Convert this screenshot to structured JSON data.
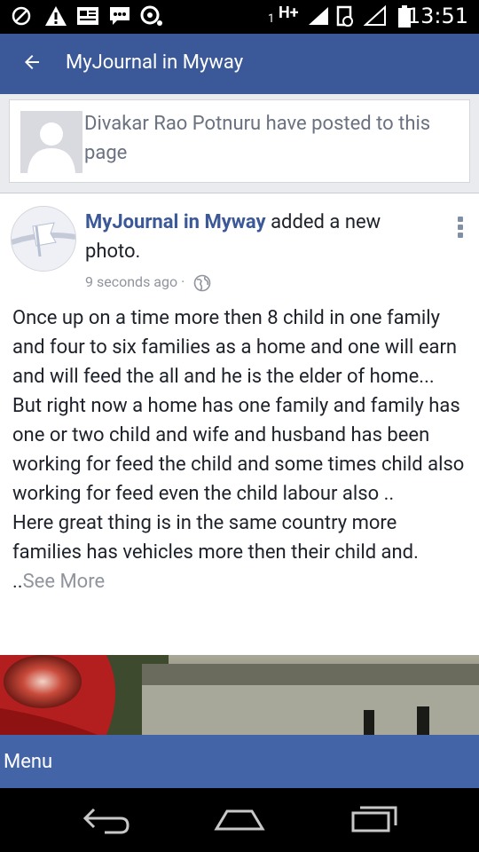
{
  "status_bar": {
    "sim_number": "1",
    "network_type": "H+",
    "time": "13:51"
  },
  "app_bar": {
    "title": "MyJournal in Myway",
    "back_icon": "arrow-left-icon"
  },
  "notice": {
    "text": "Divakar Rao Potnuru have posted to this page"
  },
  "post": {
    "page_name": "MyJournal in Myway",
    "action_text": " added a new photo.",
    "timestamp": "9 seconds ago",
    "separator": "·",
    "privacy_icon": "globe-icon",
    "paragraphs": [
      "Once up on a time more then 8 child in one family and four to six families as a home and one will earn and will feed the all and he is the elder of home...",
      "But right now a home has one family and family has one or two child and wife and husband has been working for feed the child and some times child also working for feed even the child labour also ..",
      "Here great thing is in the same country more families has vehicles more then their child and."
    ],
    "ellipsis": "..",
    "see_more": "See More"
  },
  "menu": {
    "label": "Menu"
  },
  "colors": {
    "brand": "#3b5998",
    "menu_bar": "#4464a8",
    "background": "#e9ebee"
  }
}
